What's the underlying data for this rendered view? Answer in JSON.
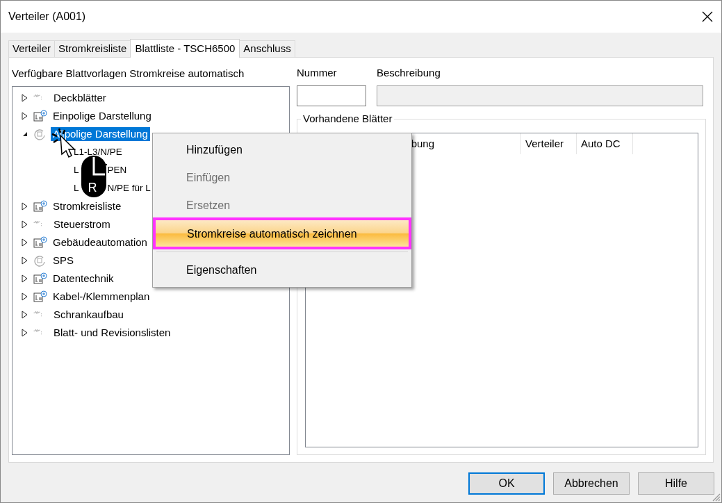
{
  "window": {
    "title": "Verteiler  (A001)"
  },
  "tabs": [
    {
      "label": "Verteiler",
      "selected": false
    },
    {
      "label": "Stromkreisliste",
      "selected": false
    },
    {
      "label": "Blattliste - TSCH6500",
      "selected": true
    },
    {
      "label": "Anschluss",
      "selected": false
    }
  ],
  "tree": {
    "label": "Verfügbare Blattvorlagen Stromkreise automatisch",
    "items": [
      {
        "label": "Deckblätter",
        "kind": "wave",
        "expanded": false,
        "selected": false
      },
      {
        "label": "Einpolige Darstellung",
        "kind": "sheet",
        "expanded": false,
        "selected": false
      },
      {
        "label": "Allpolige Darstellung",
        "kind": "cycle",
        "expanded": true,
        "selected": true,
        "children": [
          {
            "label": "L1-L3/N/PE",
            "selected": false
          },
          {
            "parts": [
              "L",
              "PEN"
            ],
            "selected": false
          },
          {
            "parts": [
              "L",
              "N/PE für L"
            ],
            "selected": false
          }
        ]
      },
      {
        "label": "Stromkreisliste",
        "kind": "sheet",
        "expanded": false,
        "selected": false
      },
      {
        "label": "Steuerstrom",
        "kind": "wave",
        "expanded": false,
        "selected": false
      },
      {
        "label": "Gebäudeautomation",
        "kind": "sheet",
        "expanded": false,
        "selected": false
      },
      {
        "label": "SPS",
        "kind": "cycle",
        "expanded": false,
        "selected": false
      },
      {
        "label": "Datentechnik",
        "kind": "sheet",
        "expanded": false,
        "selected": false
      },
      {
        "label": "Kabel-/Klemmenplan",
        "kind": "sheet",
        "expanded": false,
        "selected": false
      },
      {
        "label": "Schrankaufbau",
        "kind": "wave",
        "expanded": false,
        "selected": false
      },
      {
        "label": "Blatt- und Revisionslisten",
        "kind": "wave",
        "expanded": false,
        "selected": false
      }
    ]
  },
  "fields": [
    {
      "label": "Nummer",
      "disabled": false
    },
    {
      "label": "Beschreibung",
      "disabled": true
    }
  ],
  "sheets": {
    "title": "Vorhandene Blätter",
    "columns": [
      "bung",
      "Verteiler",
      "Auto DC"
    ]
  },
  "context_menu": [
    {
      "label": "Hinzufügen",
      "disabled": false,
      "selected": false
    },
    {
      "label": "Einfügen",
      "disabled": true,
      "selected": false
    },
    {
      "label": "Ersetzen",
      "disabled": true,
      "selected": false
    },
    {
      "label": "Stromkreise automatisch zeichnen",
      "disabled": false,
      "selected": true
    },
    {
      "label": "Eigenschaften",
      "disabled": false,
      "selected": false
    }
  ],
  "mouse_hint": {
    "button": "R"
  },
  "buttons": [
    {
      "label": "OK",
      "selected": true
    },
    {
      "label": "Abbrechen",
      "selected": false
    },
    {
      "label": "Hilfe",
      "selected": false
    }
  ]
}
